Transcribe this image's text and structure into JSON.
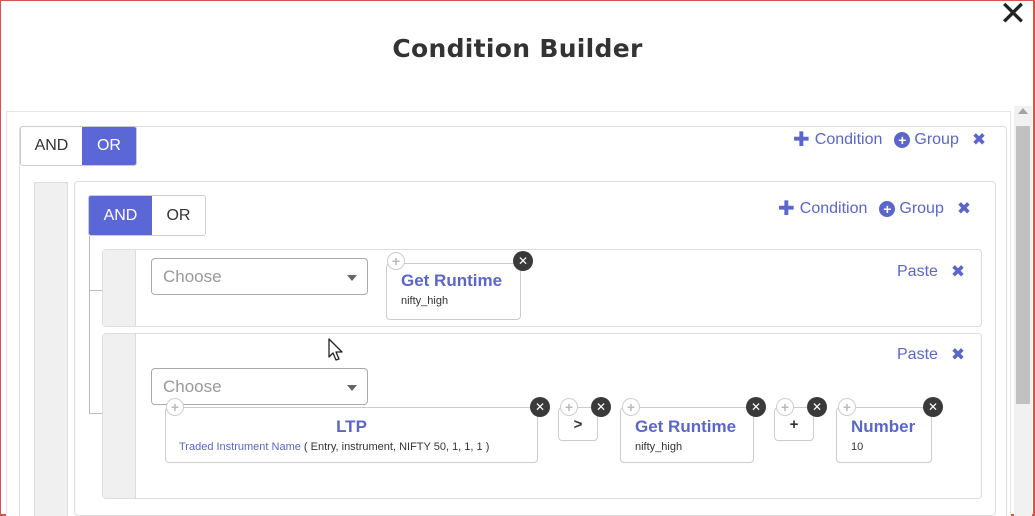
{
  "dialog": {
    "title": "Condition Builder",
    "close_icon": "close-icon"
  },
  "root_group": {
    "toggle": {
      "and_label": "AND",
      "or_label": "OR",
      "selected": "OR"
    },
    "actions": {
      "condition_label": "Condition",
      "group_label": "Group"
    }
  },
  "inner_group": {
    "toggle": {
      "and_label": "AND",
      "or_label": "OR",
      "selected": "AND"
    },
    "actions": {
      "condition_label": "Condition",
      "group_label": "Group"
    }
  },
  "rules": [
    {
      "select_placeholder": "Choose",
      "paste_label": "Paste",
      "nodes": [
        {
          "title": "Get Runtime",
          "subtitle": "nifty_high"
        }
      ]
    },
    {
      "select_placeholder": "Choose",
      "paste_label": "Paste",
      "nodes": [
        {
          "title": "LTP",
          "subtitle_link": "Traded Instrument Name",
          "subtitle_rest": " ( Entry, instrument, NIFTY 50, 1, 1, 1 )"
        },
        {
          "operator": ">"
        },
        {
          "title": "Get Runtime",
          "subtitle": "nifty_high"
        },
        {
          "operator": "+"
        },
        {
          "title": "Number",
          "subtitle": "10"
        }
      ]
    }
  ],
  "colors": {
    "accent": "#5b67d6",
    "link": "#5a66c9",
    "frame_border": "#d9534f"
  }
}
